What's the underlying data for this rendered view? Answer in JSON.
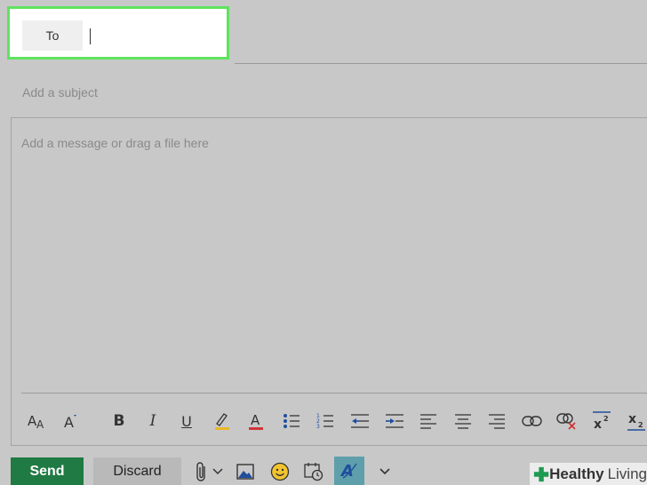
{
  "recipients": {
    "to_label": "To"
  },
  "subject": {
    "placeholder": "Add a subject"
  },
  "message": {
    "placeholder": "Add a message or drag a file here"
  },
  "formatting_toolbar": {
    "items": [
      {
        "name": "font-size-icon",
        "glyph": "AA"
      },
      {
        "name": "grow-font-icon",
        "glyph": "A"
      },
      {
        "name": "bold-icon",
        "glyph": "B"
      },
      {
        "name": "italic-icon",
        "glyph": "I"
      },
      {
        "name": "underline-icon",
        "glyph": "U"
      },
      {
        "name": "highlight-icon",
        "glyph": "ab"
      },
      {
        "name": "font-color-icon",
        "glyph": "A"
      },
      {
        "name": "bullets-icon",
        "glyph": "bullets"
      },
      {
        "name": "numbering-icon",
        "glyph": "numbers"
      },
      {
        "name": "decrease-indent-icon",
        "glyph": "outdent"
      },
      {
        "name": "increase-indent-icon",
        "glyph": "indent"
      },
      {
        "name": "align-left-icon",
        "glyph": "left"
      },
      {
        "name": "align-center-icon",
        "glyph": "center"
      },
      {
        "name": "align-right-icon",
        "glyph": "right"
      },
      {
        "name": "insert-link-icon",
        "glyph": "link"
      },
      {
        "name": "remove-link-icon",
        "glyph": "unlink"
      },
      {
        "name": "superscript-icon",
        "glyph": "x2"
      },
      {
        "name": "subscript-icon",
        "glyph": "x2"
      }
    ]
  },
  "actions": {
    "send_label": "Send",
    "discard_label": "Discard"
  },
  "bottom_toolbar": {
    "icons": [
      "paperclip-icon",
      "chevron-down-icon",
      "insert-picture-icon",
      "emoji-icon",
      "schedule-icon",
      "editor-icon",
      "more-options-icon"
    ]
  },
  "watermark": {
    "brand": "Healthy",
    "brand2": "Living"
  },
  "colors": {
    "background": "#c8c8c8",
    "highlight_border": "#5fe35f",
    "send": "#1f7a44",
    "indent_arrow": "#1f4e9c",
    "highlight_yellow": "#e8b829",
    "font_red": "#d13438",
    "watermark_green": "#1e9a52"
  }
}
